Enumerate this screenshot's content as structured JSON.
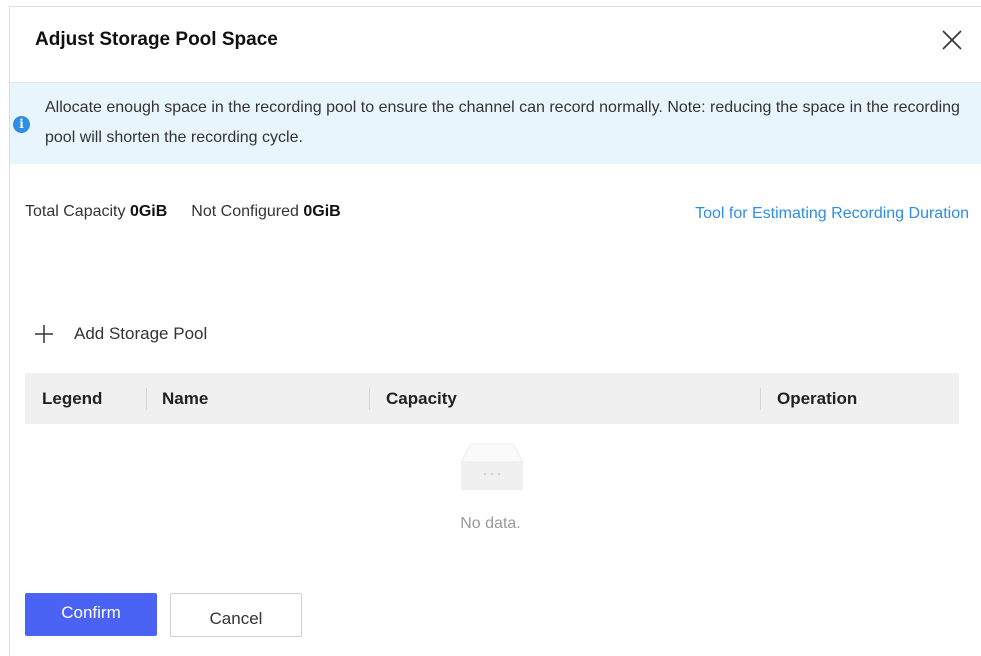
{
  "dialog": {
    "title": "Adjust Storage Pool Space",
    "close_icon": "close-icon"
  },
  "notice": {
    "icon": "info-icon",
    "icon_glyph": "i",
    "text": "Allocate enough space in the recording pool to ensure the channel can record normally. Note: reducing the space in the recording pool will shorten the recording cycle."
  },
  "summary": {
    "total_label": "Total Capacity",
    "total_value": "0GiB",
    "not_configured_label": "Not Configured",
    "not_configured_value": "0GiB",
    "tool_link": "Tool for Estimating Recording Duration"
  },
  "add_pool": {
    "icon": "plus-icon",
    "label": "Add Storage Pool"
  },
  "table": {
    "columns": [
      "Legend",
      "Name",
      "Capacity",
      "Operation"
    ],
    "rows": [],
    "empty_text": "No data."
  },
  "footer": {
    "confirm_label": "Confirm",
    "cancel_label": "Cancel"
  },
  "colors": {
    "accent": "#4a63f5",
    "link": "#2f8de4",
    "notice_bg": "#e9f5fc",
    "table_header_bg": "#f0f0f0"
  }
}
